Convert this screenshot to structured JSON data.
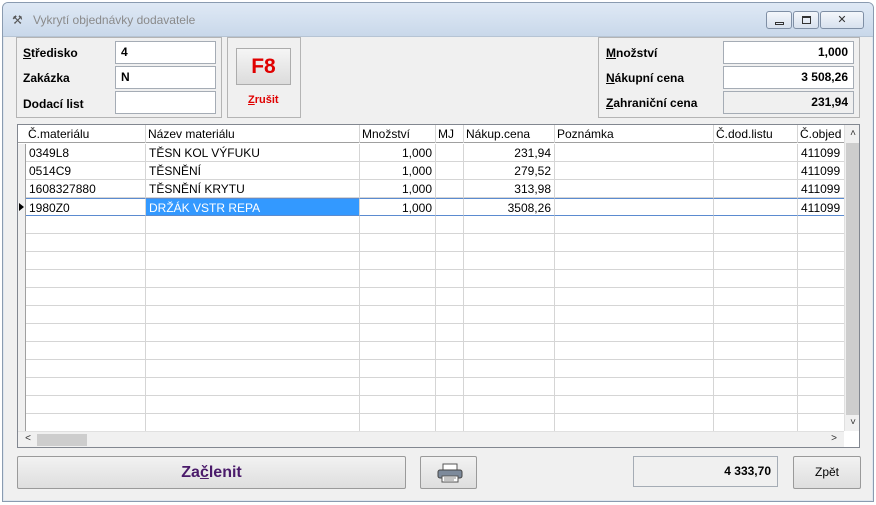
{
  "window": {
    "title": "Vykrytí objednávky dodavatele"
  },
  "left": {
    "stredisko_label": "Středisko",
    "stredisko_value": "4",
    "zakazka_label": "Zakázka",
    "zakazka_value": "N",
    "dodaci_label": "Dodací list",
    "dodaci_value": "",
    "f8_label": "F8",
    "zrusit_label": "Zrušit"
  },
  "right": {
    "mnozstvi_label": "Množství",
    "mnozstvi_value": "1,000",
    "nakupni_label": "Nákupní cena",
    "nakupni_value": "3 508,26",
    "zahranicni_label": "Zahraniční cena",
    "zahranicni_value": "231,94"
  },
  "table": {
    "columns": [
      "Č.materiálu",
      "Název materiálu",
      "Množství",
      "MJ",
      "Nákup.cena",
      "Poznámka",
      "Č.dod.listu",
      "Č.objed"
    ],
    "rows": [
      [
        "0349L8",
        "TĚSN KOL VÝFUKU",
        "1,000",
        "",
        "231,94",
        "",
        "",
        "411099"
      ],
      [
        "0514C9",
        "TĚSNĚNÍ",
        "1,000",
        "",
        "279,52",
        "",
        "",
        "411099"
      ],
      [
        "1608327880",
        "TĚSNĚNÍ KRYTU",
        "1,000",
        "",
        "313,98",
        "",
        "",
        "411099"
      ],
      [
        "1980Z0",
        "DRŽÁK VSTR REPA",
        "1,000",
        "",
        "3508,26",
        "",
        "",
        "411099"
      ]
    ],
    "selected_row": 3
  },
  "footer": {
    "zaclenit_label": "Začlenit",
    "total_value": "4 333,70",
    "zpet_label": "Zpět"
  },
  "icons": {
    "app": "tools-icon",
    "printer": "printer-icon"
  }
}
